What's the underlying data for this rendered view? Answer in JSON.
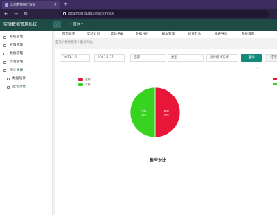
{
  "browser": {
    "tab_title": "实验数据统计系统",
    "url": "localhost:8080/stats/index"
  },
  "app": {
    "title": "实验数据管理系统",
    "collapse_icon": "collapse-icon",
    "header_menu": "+ 首页 ▾"
  },
  "sidebar": {
    "items": [
      {
        "label": "系统管理",
        "icon": "settings-icon"
      },
      {
        "label": "权限管理",
        "icon": "shield-icon"
      },
      {
        "label": "数据管理",
        "icon": "database-icon"
      },
      {
        "label": "实验管理",
        "icon": "flask-icon"
      },
      {
        "label": "统计报表",
        "icon": "chart-icon"
      },
      {
        "label": "数据统计",
        "icon": "report-icon"
      },
      {
        "label": "盈亏对比",
        "icon": "compare-icon"
      }
    ]
  },
  "function_tabs": [
    "首页概览",
    "实验计划",
    "实验记录",
    "数据分析",
    "样本管理",
    "结果汇总",
    "报表导出",
    "系统日志"
  ],
  "breadcrumb": "首页 / 统计报表 / 盈亏对比",
  "filters": {
    "start_date": "2023-1-1",
    "end_date": "2023-1-31",
    "project": "全部",
    "category": "类型",
    "type_select": "盈亏统计方式"
  },
  "buttons": {
    "query": "查询",
    "print": "打印",
    "export_icon": "export-icon"
  },
  "chart_data": {
    "type": "pie",
    "title": "盈亏对比",
    "series": [
      {
        "name": "盈利",
        "value": 50,
        "label": "50%",
        "color": "#e8173a"
      },
      {
        "name": "亏损",
        "value": 50,
        "label": "50%",
        "color": "#38d321"
      }
    ],
    "legend_position": "top-left"
  }
}
